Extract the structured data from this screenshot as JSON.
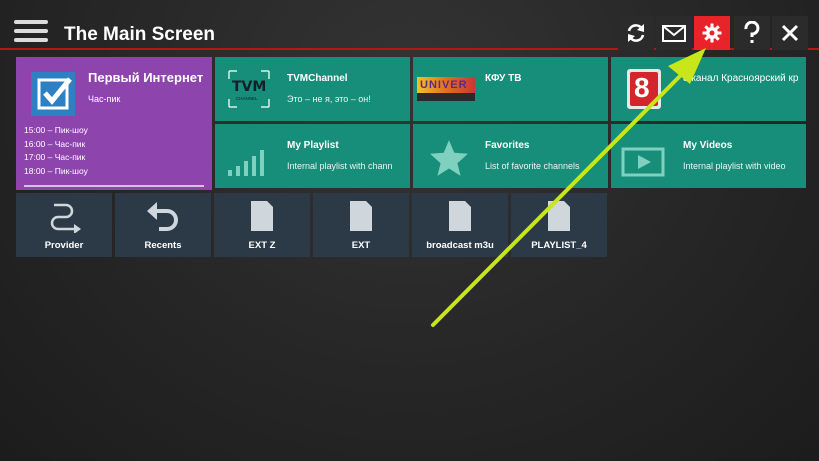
{
  "header": {
    "title": "The Main Screen",
    "buttons": [
      {
        "name": "refresh-button",
        "icon": "refresh-icon"
      },
      {
        "name": "messages-button",
        "icon": "envelope-icon"
      },
      {
        "name": "settings-button",
        "icon": "gear-icon",
        "active": true
      },
      {
        "name": "help-button",
        "icon": "question-icon"
      },
      {
        "name": "close-button",
        "icon": "close-icon"
      }
    ]
  },
  "featured": {
    "title": "Первый Интернет",
    "subtitle": "Час-пик",
    "schedule": [
      "15:00 – Пик-шоу",
      "16:00 – Час-пик",
      "17:00 – Час-пик",
      "18:00 – Пик-шоу"
    ]
  },
  "channels": [
    {
      "title": "TVMChannel",
      "subtitle": "Это – не я, это – он!",
      "logo_text": "TVM",
      "logo_sub": "CHANNEL"
    },
    {
      "title": "КФУ ТВ",
      "subtitle": "",
      "logo_text": "UNIVER"
    },
    {
      "title": "8 канал Красноярский кр",
      "subtitle": "",
      "logo_text": "8"
    }
  ],
  "lists": [
    {
      "title": "My Playlist",
      "subtitle": "Internal playlist with chann",
      "icon": "bars-icon"
    },
    {
      "title": "Favorites",
      "subtitle": "List of favorite channels",
      "icon": "star-icon"
    },
    {
      "title": "My Videos",
      "subtitle": "Internal playlist with video",
      "icon": "video-icon"
    }
  ],
  "shortcuts": [
    {
      "label": "Provider",
      "icon": "provider-icon"
    },
    {
      "label": "Recents",
      "icon": "undo-icon"
    },
    {
      "label": "EXT Z",
      "icon": "file-icon"
    },
    {
      "label": "EXT",
      "icon": "file-icon"
    },
    {
      "label": "broadcast m3u",
      "icon": "file-icon"
    },
    {
      "label": "PLAYLIST_4",
      "icon": "file-icon"
    }
  ],
  "colors": {
    "accent_red": "#e8232a",
    "tile_teal": "#178e79",
    "tile_purple": "#8e44ad",
    "tile_slate": "#2c3a48",
    "pointer_arrow": "#c8e619"
  }
}
